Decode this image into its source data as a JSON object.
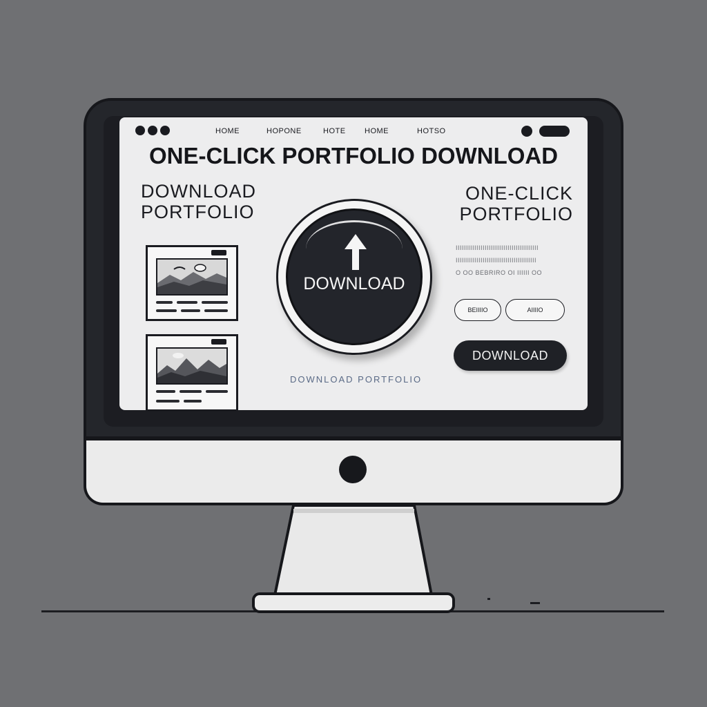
{
  "window": {
    "nav": [
      "HOME",
      "HOPONE",
      "HOTE",
      "HOME",
      "HOTSO"
    ]
  },
  "page": {
    "title": "ONE-CLICK PORTFOLIO DOWNLOAD",
    "left_heading": [
      "DOWNLOAD",
      "PORTFOLIO"
    ],
    "right_heading": [
      "ONE-CLICK",
      "PORTFOLIO"
    ],
    "download_circle_label": "DOWNLOAD",
    "caption": "DOWNLOAD PORTFOLIO",
    "text_rows": [
      "IIIIIIIIIIIIIIIIIIIIIIIIIIIIIIIIIIIIIIII",
      "IIIIIIIIIIIIIIIIIIIIIIIIIIIIIIIIIIIIIII",
      "O OO BEBRIRO OI IIIIII OO"
    ],
    "small_buttons": [
      "BEIIIIO",
      "AIIIIO"
    ],
    "primary_button": "DOWNLOAD"
  },
  "colors": {
    "background": "#6f7073",
    "screen": "#ededee",
    "ink": "#1a1b20",
    "caption": "#5a6a86"
  },
  "icons": {
    "download_circle": "upload-arrow-icon",
    "thumbnails": "landscape-image-icon"
  }
}
